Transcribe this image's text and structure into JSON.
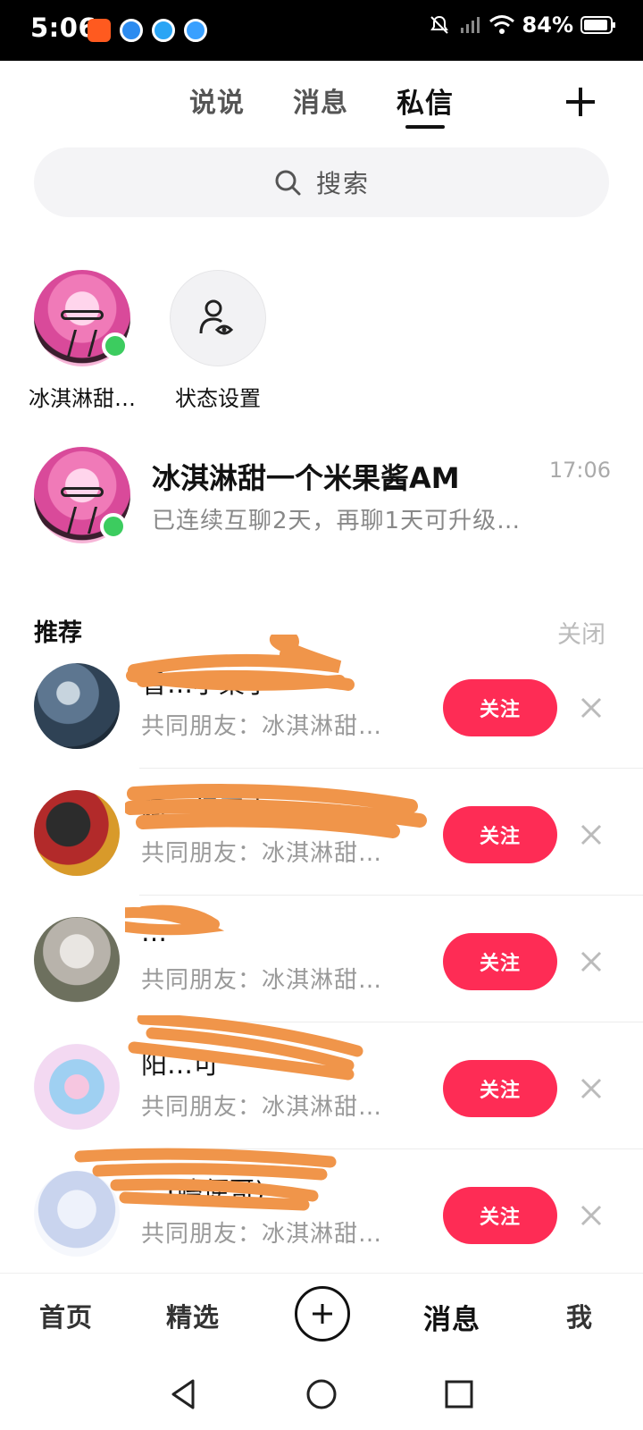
{
  "status_bar": {
    "time": "5:06",
    "battery": "84%",
    "icons": [
      "bell-muted-icon",
      "signal-icon",
      "wifi-icon",
      "battery-icon"
    ]
  },
  "top_tabs": [
    "说说",
    "消息",
    "私信"
  ],
  "active_tab": "私信",
  "search": {
    "placeholder": "搜索"
  },
  "stories": [
    {
      "name": "冰淇淋甜…",
      "online": true
    },
    {
      "name": "状态设置",
      "online": false
    }
  ],
  "conversation": {
    "name": "冰淇淋甜一个米果酱AM",
    "time": "17:06",
    "preview": "已连续互聊2天，再聊1天可升级…",
    "online": true
  },
  "recommend": {
    "title": "推荐",
    "close_label": "关闭",
    "follow_label": "关注",
    "items": [
      {
        "name": "香…小梨子",
        "mutual": "共同朋友：冰淇淋甜…"
      },
      {
        "name": "阿…得罗夫",
        "mutual": "共同朋友：冰淇淋甜…"
      },
      {
        "name": "…",
        "mutual": "共同朋友：冰淇淋甜…"
      },
      {
        "name": "阳…可",
        "mutual": "共同朋友：冰淇淋甜…"
      },
      {
        "name": "…(嗑便哥)",
        "mutual": "共同朋友：冰淇淋甜…"
      }
    ]
  },
  "bottom_nav": {
    "home": "首页",
    "featured": "精选",
    "messages": "消息",
    "me": "我"
  },
  "colors": {
    "accent": "#fe2c55",
    "online": "#3ccc5f",
    "scribble": "#f0954a"
  }
}
